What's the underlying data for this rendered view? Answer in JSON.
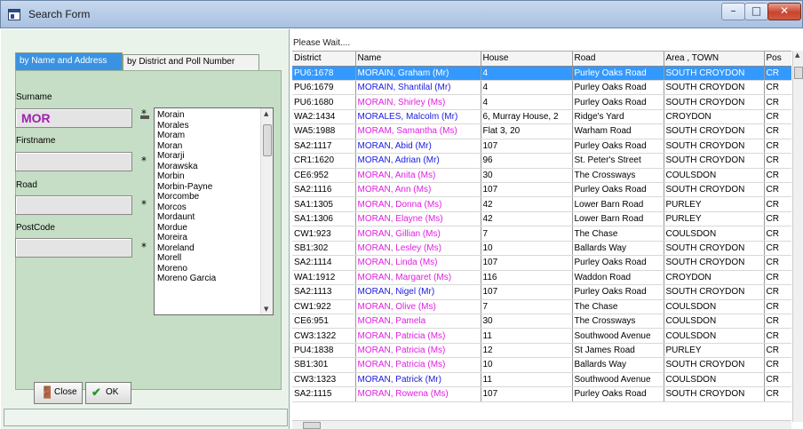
{
  "window": {
    "title": "Search Form",
    "minimize": "–",
    "maximize": "□",
    "close": "✕"
  },
  "tabs": [
    {
      "label": "by Name and Address",
      "active": true
    },
    {
      "label": "by District and Poll Number",
      "active": false
    }
  ],
  "form": {
    "surname_label": "Surname",
    "surname_value": "MOR",
    "firstname_label": "Firstname",
    "road_label": "Road",
    "postcode_label": "PostCode",
    "wildcard": "*"
  },
  "surname_list": [
    "Morain",
    "Morales",
    "Moram",
    "Moran",
    "Morarji",
    "Morawska",
    "Morbin",
    "Morbin-Payne",
    "Morcombe",
    "Morcos",
    "Mordaunt",
    "Mordue",
    "Moreira",
    "Moreland",
    "Morell",
    "Moreno",
    "Moreno Garcia"
  ],
  "buttons": {
    "close": "Close",
    "ok": "OK"
  },
  "results": {
    "status": "Please Wait....",
    "columns": [
      "District",
      "Name",
      "House",
      "Road",
      "Area , TOWN",
      "Pos"
    ],
    "rows": [
      [
        "PU6:1678",
        "MORAIN, Graham (Mr)",
        "4",
        "Purley Oaks Road",
        "SOUTH CROYDON",
        "CR",
        "b",
        true
      ],
      [
        "PU6:1679",
        "MORAIN, Shantilal (Mr)",
        "4",
        "Purley Oaks Road",
        "SOUTH CROYDON",
        "CR",
        "b",
        false
      ],
      [
        "PU6:1680",
        "MORAIN, Shirley (Ms)",
        "4",
        "Purley Oaks Road",
        "SOUTH CROYDON",
        "CR",
        "m",
        false
      ],
      [
        "WA2:1434",
        "MORALES, Malcolm (Mr)",
        "6, Murray House, 2",
        "Ridge's Yard",
        "CROYDON",
        "CR",
        "b",
        false
      ],
      [
        "WA5:1988",
        "MORAM, Samantha (Ms)",
        "Flat 3, 20",
        "Warham Road",
        "SOUTH CROYDON",
        "CR",
        "m",
        false
      ],
      [
        "SA2:1117",
        "MORAN, Abid (Mr)",
        "107",
        "Purley Oaks Road",
        "SOUTH CROYDON",
        "CR",
        "b",
        false
      ],
      [
        "CR1:1620",
        "MORAN, Adrian (Mr)",
        "96",
        "St. Peter's Street",
        "SOUTH CROYDON",
        "CR",
        "b",
        false
      ],
      [
        "CE6:952",
        "MORAN, Anita (Ms)",
        "30",
        "The Crossways",
        "COULSDON",
        "CR",
        "m",
        false
      ],
      [
        "SA2:1116",
        "MORAN, Ann (Ms)",
        "107",
        "Purley Oaks Road",
        "SOUTH CROYDON",
        "CR",
        "m",
        false
      ],
      [
        "SA1:1305",
        "MORAN, Donna (Ms)",
        "42",
        "Lower Barn Road",
        "PURLEY",
        "CR",
        "m",
        false
      ],
      [
        "SA1:1306",
        "MORAN, Elayne (Ms)",
        "42",
        "Lower Barn Road",
        "PURLEY",
        "CR",
        "m",
        false
      ],
      [
        "CW1:923",
        "MORAN, Gillian (Ms)",
        "7",
        "The Chase",
        "COULSDON",
        "CR",
        "m",
        false
      ],
      [
        "SB1:302",
        "MORAN, Lesley (Ms)",
        "10",
        "Ballards Way",
        "SOUTH CROYDON",
        "CR",
        "m",
        false
      ],
      [
        "SA2:1114",
        "MORAN, Linda (Ms)",
        "107",
        "Purley Oaks Road",
        "SOUTH CROYDON",
        "CR",
        "m",
        false
      ],
      [
        "WA1:1912",
        "MORAN, Margaret (Ms)",
        "116",
        "Waddon Road",
        "CROYDON",
        "CR",
        "m",
        false
      ],
      [
        "SA2:1113",
        "MORAN, Nigel (Mr)",
        "107",
        "Purley Oaks Road",
        "SOUTH CROYDON",
        "CR",
        "b",
        false
      ],
      [
        "CW1:922",
        "MORAN, Olive (Ms)",
        "7",
        "The Chase",
        "COULSDON",
        "CR",
        "m",
        false
      ],
      [
        "CE6:951",
        "MORAN, Pamela",
        "30",
        "The Crossways",
        "COULSDON",
        "CR",
        "m",
        false
      ],
      [
        "CW3:1322",
        "MORAN, Patricia (Ms)",
        "11",
        "Southwood Avenue",
        "COULSDON",
        "CR",
        "m",
        false
      ],
      [
        "PU4:1838",
        "MORAN, Patricia (Ms)",
        "12",
        "St James Road",
        "PURLEY",
        "CR",
        "m",
        false
      ],
      [
        "SB1:301",
        "MORAN, Patricia (Ms)",
        "10",
        "Ballards Way",
        "SOUTH CROYDON",
        "CR",
        "m",
        false
      ],
      [
        "CW3:1323",
        "MORAN, Patrick (Mr)",
        "11",
        "Southwood Avenue",
        "COULSDON",
        "CR",
        "b",
        false
      ],
      [
        "SA2:1115",
        "MORAN, Rowena (Ms)",
        "107",
        "Purley Oaks Road",
        "SOUTH CROYDON",
        "CR",
        "m",
        false
      ]
    ]
  },
  "colors": {
    "selected_row": "#3399ff",
    "female_name": "#e020e0",
    "male_name": "#1a1ae0",
    "active_tab": "#3a93e2",
    "panel": "#c6dec6"
  }
}
